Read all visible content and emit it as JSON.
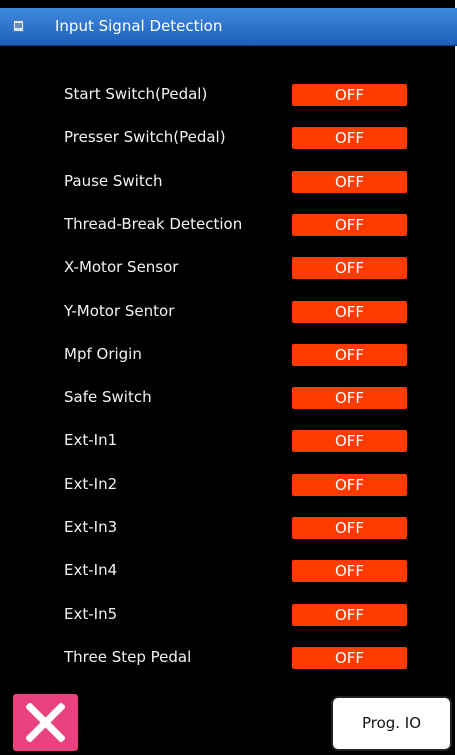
{
  "window": {
    "title": "Input Signal Detection",
    "icon": "window-icon"
  },
  "signals": [
    {
      "label": "Start Switch(Pedal)",
      "state": "OFF"
    },
    {
      "label": "Presser Switch(Pedal)",
      "state": "OFF"
    },
    {
      "label": "Pause Switch",
      "state": "OFF"
    },
    {
      "label": "Thread-Break Detection",
      "state": "OFF"
    },
    {
      "label": "X-Motor Sensor",
      "state": "OFF"
    },
    {
      "label": "Y-Motor Sentor",
      "state": "OFF"
    },
    {
      "label": "Mpf Origin",
      "state": "OFF"
    },
    {
      "label": "Safe Switch",
      "state": "OFF"
    },
    {
      "label": "Ext-In1",
      "state": "OFF"
    },
    {
      "label": "Ext-In2",
      "state": "OFF"
    },
    {
      "label": "Ext-In3",
      "state": "OFF"
    },
    {
      "label": "Ext-In4",
      "state": "OFF"
    },
    {
      "label": "Ext-In5",
      "state": "OFF"
    },
    {
      "label": "Three Step Pedal",
      "state": "OFF"
    }
  ],
  "footer": {
    "close_icon": "close-icon",
    "prog_io_label": "Prog. IO"
  },
  "colors": {
    "title_bar": "#2f78d2",
    "background": "#000000",
    "state_off": "#ff3b00",
    "close_button": "#e9427e"
  }
}
